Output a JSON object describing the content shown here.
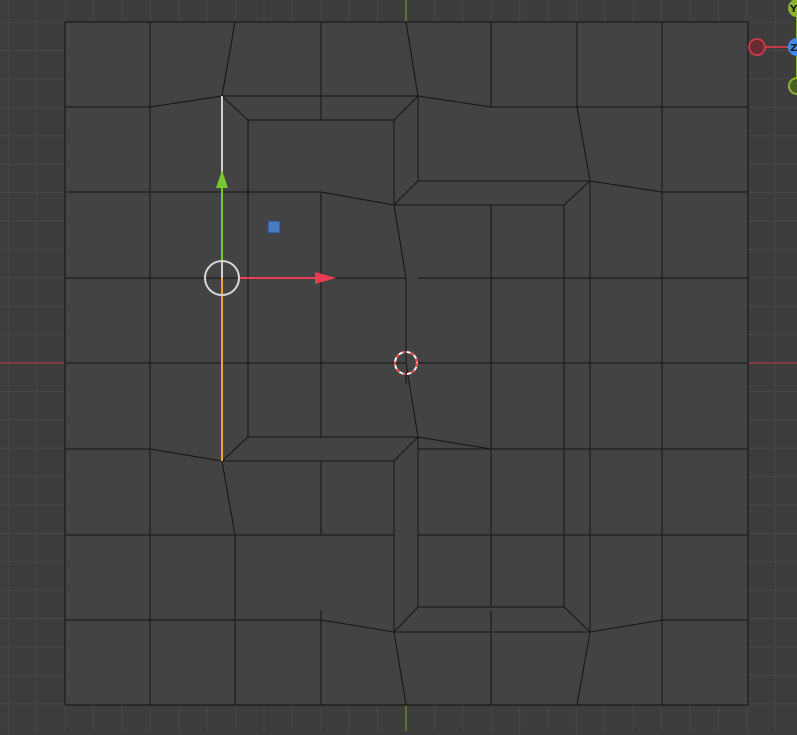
{
  "viewport": {
    "background_color": "#3d3d3d",
    "grid_color": "#474747",
    "mesh_face_color": "#434343",
    "mesh_edge_color": "#111111",
    "x_axis_color": "#c23a3a",
    "y_axis_color": "#7aa52a"
  },
  "transform_gizmo": {
    "x_arrow_color": "#e83d55",
    "y_arrow_color": "#79c72e",
    "selected_edge_color": "#e8a33d",
    "unselected_edge_color": "#d0d0d0"
  },
  "view_gizmo": {
    "y_label": "Y",
    "z_label": "Z",
    "x_color": "#c23d4b",
    "y_color": "#8ab32e",
    "z_color": "#3d8bf0"
  },
  "cursor_3d": {
    "icon": "crosshair-icon",
    "color_a": "#e84a4a",
    "color_b": "#ffffff"
  },
  "selected_face_marker_color": "#4a7bc0"
}
